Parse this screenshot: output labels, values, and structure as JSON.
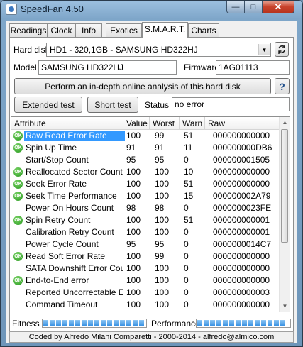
{
  "window": {
    "title": "SpeedFan 4.50"
  },
  "tabs": [
    "Readings",
    "Clock",
    "Info",
    "Exotics",
    "S.M.A.R.T.",
    "Charts"
  ],
  "smart": {
    "hard_disk_label": "Hard disk",
    "hard_disk_value": "HD1 - 320,1GB - SAMSUNG HD322HJ",
    "model_label": "Model",
    "model_value": "SAMSUNG HD322HJ",
    "firmware_label": "Firmware",
    "firmware_value": "1AG01113",
    "analysis_button": "Perform an in-depth online analysis of this hard disk",
    "help_button": "?",
    "extended_test_button": "Extended test",
    "short_test_button": "Short test",
    "status_label": "Status",
    "status_value": "no error",
    "columns": [
      "Attribute",
      "Value",
      "Worst",
      "Warn",
      "Raw"
    ],
    "ok_badge": "OK",
    "rows": [
      {
        "ok": true,
        "attr": "Raw Read Error Rate",
        "value": "100",
        "worst": "99",
        "warn": "51",
        "raw": "000000000000"
      },
      {
        "ok": true,
        "attr": "Spin Up Time",
        "value": "91",
        "worst": "91",
        "warn": "11",
        "raw": "000000000DB6"
      },
      {
        "ok": false,
        "attr": "Start/Stop Count",
        "value": "95",
        "worst": "95",
        "warn": "0",
        "raw": "000000001505"
      },
      {
        "ok": true,
        "attr": "Reallocated Sector Count",
        "value": "100",
        "worst": "100",
        "warn": "10",
        "raw": "000000000000"
      },
      {
        "ok": true,
        "attr": "Seek Error Rate",
        "value": "100",
        "worst": "100",
        "warn": "51",
        "raw": "000000000000"
      },
      {
        "ok": true,
        "attr": "Seek Time Performance",
        "value": "100",
        "worst": "100",
        "warn": "15",
        "raw": "000000002A79"
      },
      {
        "ok": false,
        "attr": "Power On Hours Count",
        "value": "98",
        "worst": "98",
        "warn": "0",
        "raw": "0000000023FE"
      },
      {
        "ok": true,
        "attr": "Spin Retry Count",
        "value": "100",
        "worst": "100",
        "warn": "51",
        "raw": "000000000001"
      },
      {
        "ok": false,
        "attr": "Calibration Retry Count",
        "value": "100",
        "worst": "100",
        "warn": "0",
        "raw": "000000000001"
      },
      {
        "ok": false,
        "attr": "Power Cycle Count",
        "value": "95",
        "worst": "95",
        "warn": "0",
        "raw": "0000000014C7"
      },
      {
        "ok": true,
        "attr": "Read Soft Error Rate",
        "value": "100",
        "worst": "99",
        "warn": "0",
        "raw": "000000000000"
      },
      {
        "ok": false,
        "attr": "SATA Downshift Error Count",
        "value": "100",
        "worst": "100",
        "warn": "0",
        "raw": "000000000000"
      },
      {
        "ok": true,
        "attr": "End-to-End error",
        "value": "100",
        "worst": "100",
        "warn": "0",
        "raw": "000000000000"
      },
      {
        "ok": false,
        "attr": "Reported Uncorrectable Er...",
        "value": "100",
        "worst": "100",
        "warn": "0",
        "raw": "000000000003"
      },
      {
        "ok": false,
        "attr": "Command Timeout",
        "value": "100",
        "worst": "100",
        "warn": "0",
        "raw": "000000000000"
      }
    ],
    "fitness_label": "Fitness",
    "fitness_level": 1.0,
    "performance_label": "Performance",
    "performance_level": 1.0
  },
  "statusbar": "Coded by Alfredo Milani Comparetti - 2000-2014 - alfredo@almico.com",
  "colors": {
    "selection": "#3399ff",
    "meter": "#2e8be0",
    "ok_badge": "#23951b"
  }
}
